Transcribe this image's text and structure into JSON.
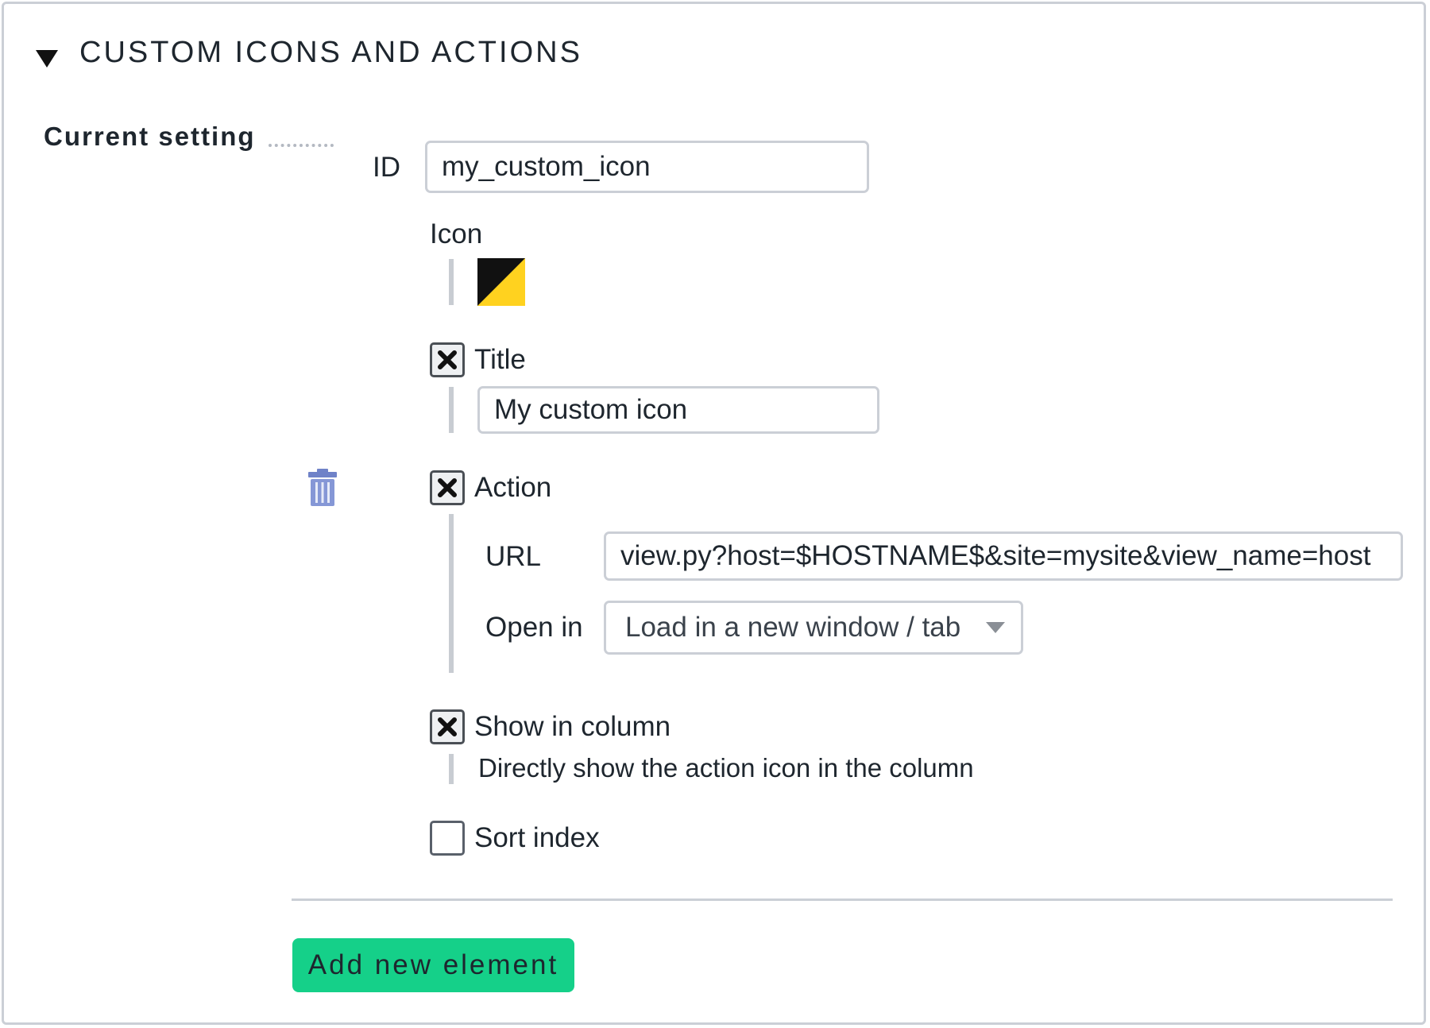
{
  "section": {
    "title": "CUSTOM ICONS AND ACTIONS",
    "toggle_icon": "triangle-down-icon"
  },
  "current_setting": {
    "label": "Current setting"
  },
  "id_field": {
    "label": "ID",
    "value": "my_custom_icon"
  },
  "icon_field": {
    "label": "Icon",
    "icon_name": "custom-icon-black-yellow-diagonal",
    "colors": {
      "dark": "#111111",
      "accent": "#ffd21f"
    }
  },
  "title_field": {
    "label": "Title",
    "checked": true,
    "value": "My custom icon"
  },
  "action_field": {
    "label": "Action",
    "checked": true,
    "url_label": "URL",
    "url_value": "view.py?host=$HOSTNAME$&site=mysite&view_name=host",
    "open_in_label": "Open in",
    "open_in_value": "Load in a new window / tab"
  },
  "show_in_column": {
    "label": "Show in column",
    "checked": true,
    "description": "Directly show the action icon in the column"
  },
  "sort_index": {
    "label": "Sort index",
    "checked": false
  },
  "delete_icon": "trash-icon",
  "add_button": {
    "label": "Add new element",
    "color": "#15d089"
  }
}
